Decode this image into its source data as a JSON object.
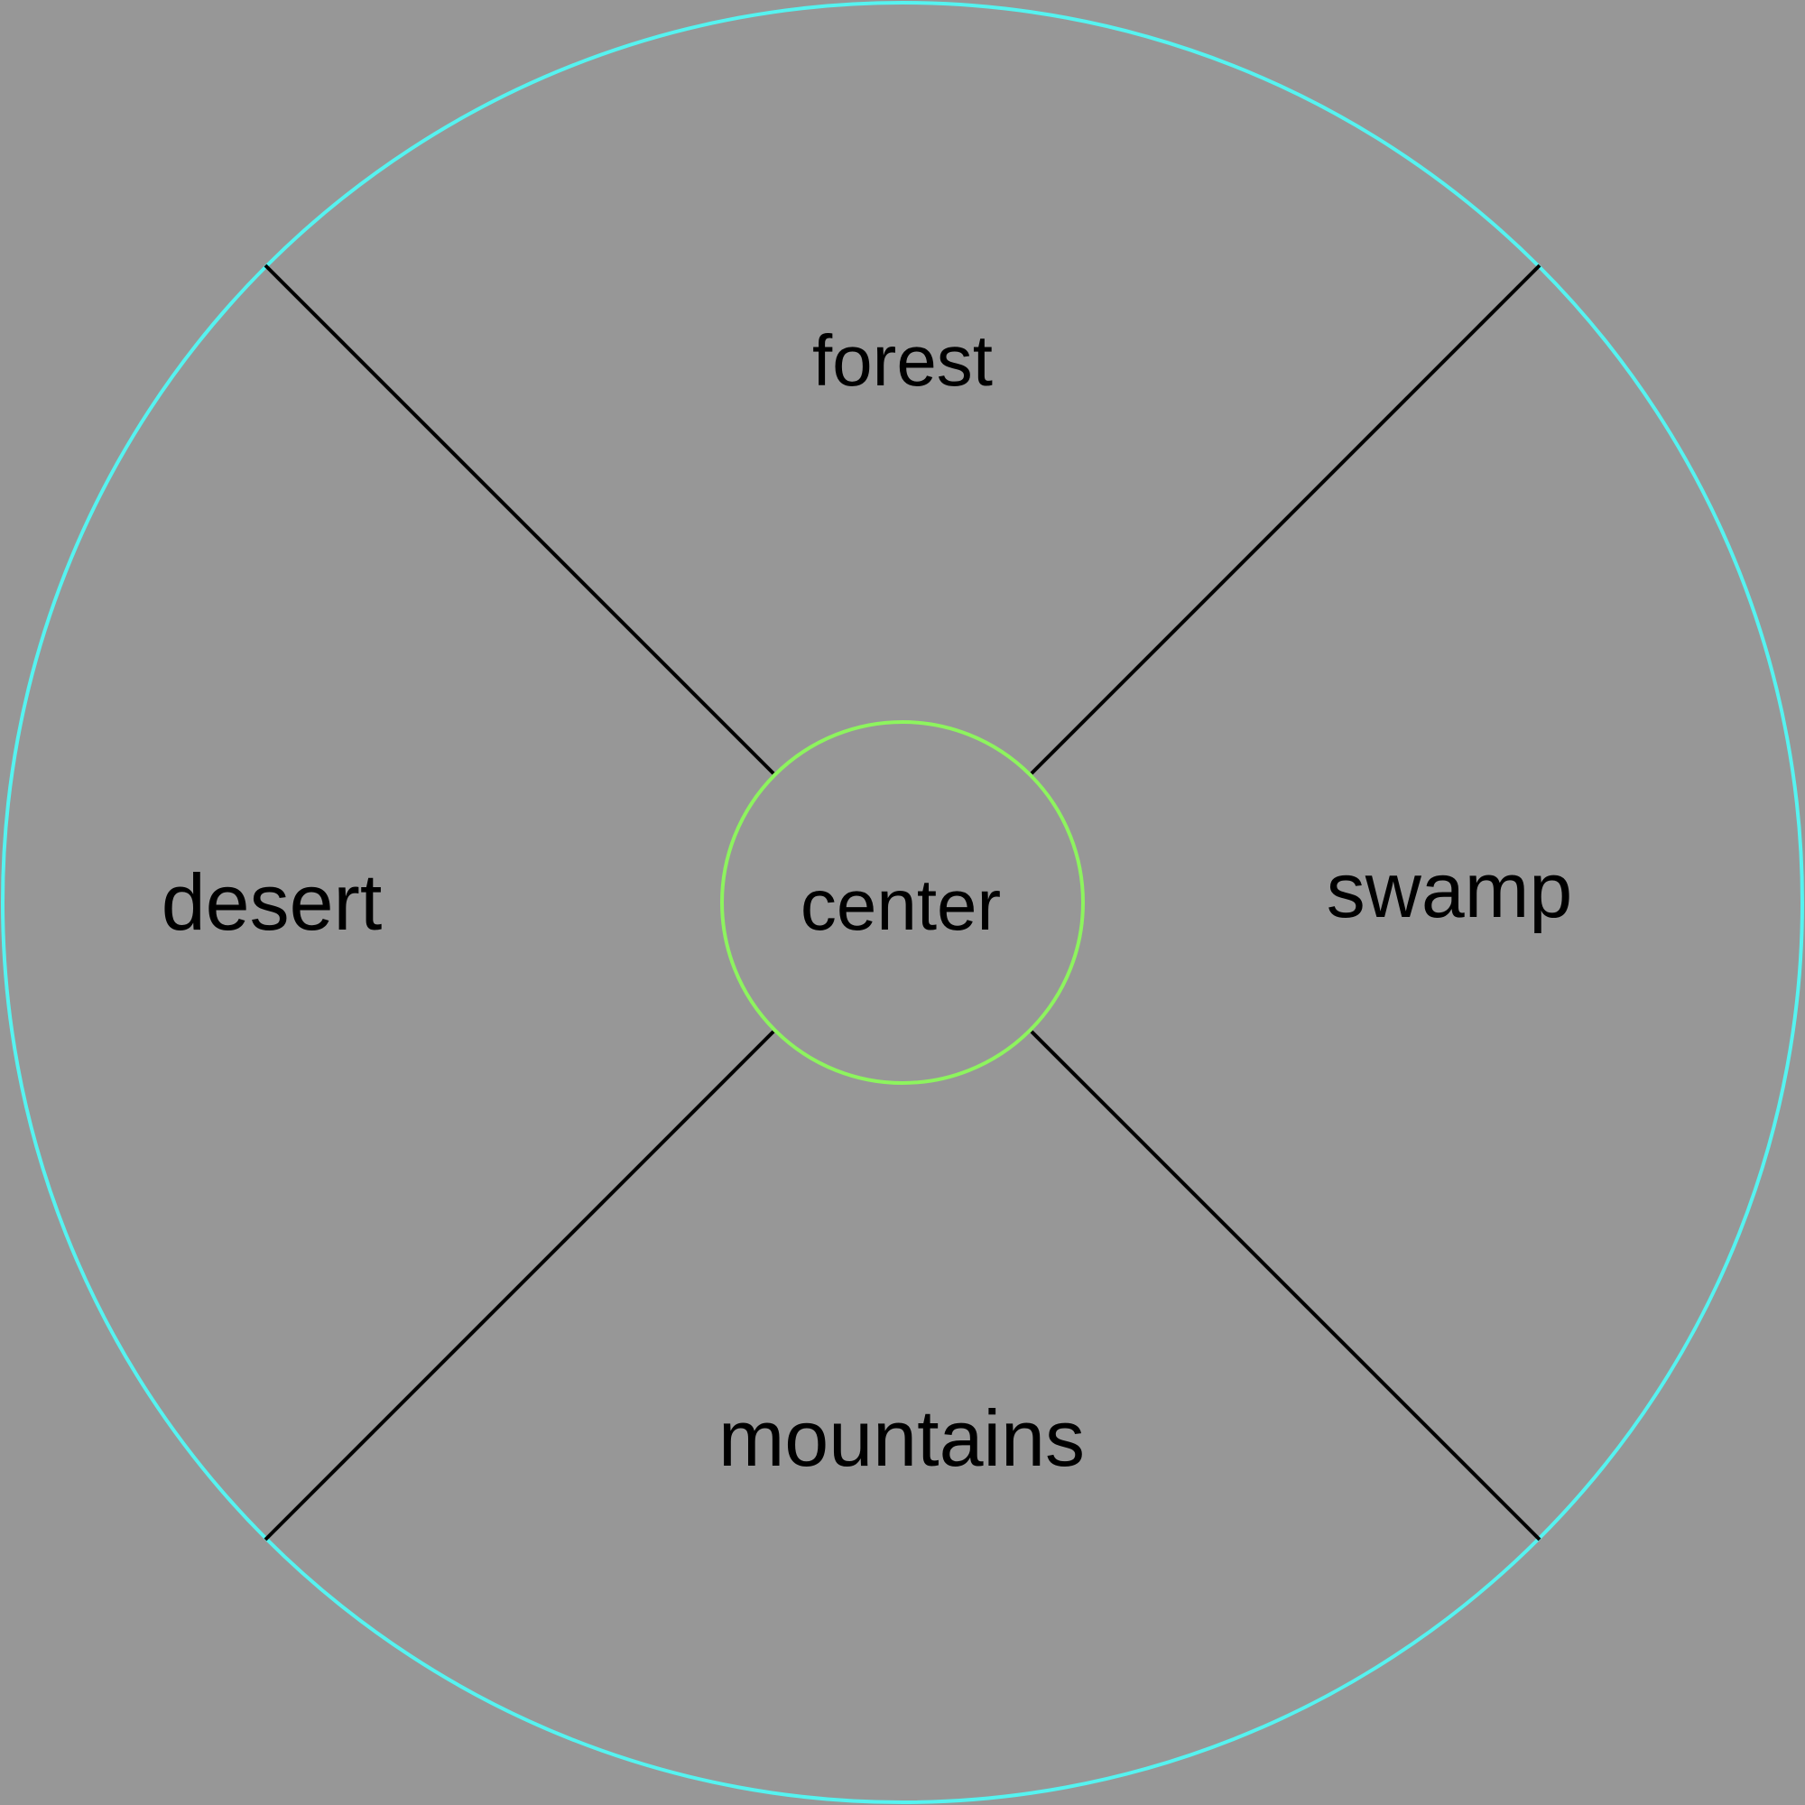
{
  "colors": {
    "background": "#979797",
    "outer_ring": "#55f3f0",
    "inner_ring": "#8df45e",
    "divider": "#000000",
    "label_text": "#000000"
  },
  "regions": {
    "forest": "forest",
    "swamp": "swamp",
    "mountains": "mountains",
    "desert": "desert",
    "center": "center"
  }
}
